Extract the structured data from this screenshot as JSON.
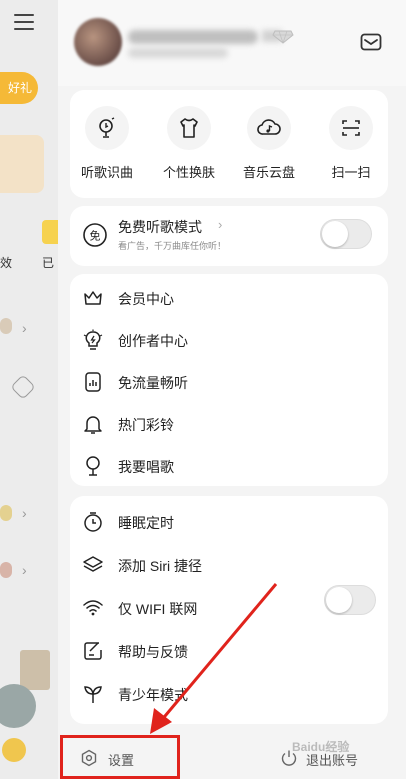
{
  "background": {
    "pill_text": "好礼",
    "text_left": "效",
    "text_right": "已"
  },
  "tools": [
    {
      "label": "听歌识曲",
      "icon": "music-recognize-icon"
    },
    {
      "label": "个性换肤",
      "icon": "tshirt-icon"
    },
    {
      "label": "音乐云盘",
      "icon": "cloud-music-icon"
    },
    {
      "label": "扫一扫",
      "icon": "scan-icon"
    }
  ],
  "free_mode": {
    "title": "免费听歌模式",
    "subtitle": "看广告，千万曲库任你听！",
    "badge": "免",
    "enabled": false
  },
  "menu_group1": [
    {
      "label": "会员中心",
      "icon": "crown-icon"
    },
    {
      "label": "创作者中心",
      "icon": "bulb-icon"
    },
    {
      "label": "免流量畅听",
      "icon": "data-free-icon"
    },
    {
      "label": "热门彩铃",
      "icon": "bell-icon"
    },
    {
      "label": "我要唱歌",
      "icon": "microphone-icon"
    }
  ],
  "menu_group2": [
    {
      "label": "睡眠定时",
      "icon": "timer-icon"
    },
    {
      "label": "添加 Siri 捷径",
      "icon": "layers-icon"
    },
    {
      "label": "仅 WIFI 联网",
      "icon": "wifi-icon"
    },
    {
      "label": "帮助与反馈",
      "icon": "feedback-icon"
    },
    {
      "label": "青少年模式",
      "icon": "sprout-icon"
    }
  ],
  "wifi_only_enabled": false,
  "bottom": {
    "settings_label": "设置",
    "logout_label": "退出账号"
  },
  "watermark": "Baidu经验",
  "colors": {
    "highlight": "#e0231c",
    "accent": "#f5b937"
  }
}
